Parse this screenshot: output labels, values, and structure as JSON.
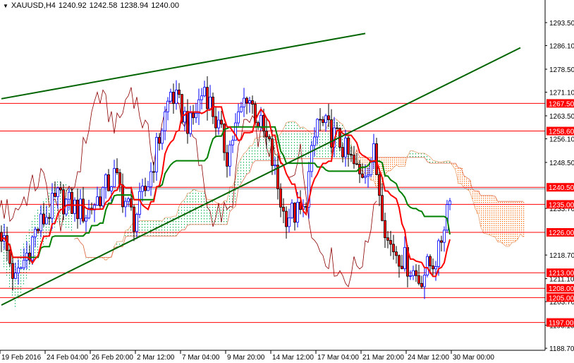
{
  "header": {
    "symbol": "XAUUSD,H4",
    "open": "1240.92",
    "high": "1242.58",
    "low": "1238.94",
    "close": "1240.00"
  },
  "colors": {
    "bull_outline": "#0000ff",
    "bull_body": "#ffffff",
    "bear_outline": "#000000",
    "bear_body": "#ff0000",
    "tenkan": "#ff0000",
    "kijun": "#008000",
    "chikou": "#8b0000",
    "cloud_bull": "#00b050",
    "cloud_bear": "#ff6600",
    "levels": "#ff0000",
    "trendline": "#006400",
    "current_price": "#8899aa"
  },
  "chart_data": {
    "type": "candlestick",
    "title": "XAUUSD,H4",
    "ylim": [
      1186.5,
      1300
    ],
    "y_ticks": [
      "1293.50",
      "1286.10",
      "1278.50",
      "1271.10",
      "1263.50",
      "1256.10",
      "1248.50",
      "1233.70",
      "1218.70",
      "1211.10",
      "1203.70",
      "1196.10",
      "1188.70"
    ],
    "x_ticks": [
      {
        "bar": 0,
        "label": "19 Feb 2016"
      },
      {
        "bar": 16,
        "label": "24 Feb 04:00"
      },
      {
        "bar": 32,
        "label": "26 Feb 20:00"
      },
      {
        "bar": 48,
        "label": "2 Mar 12:00"
      },
      {
        "bar": 64,
        "label": "7 Mar 04:00"
      },
      {
        "bar": 80,
        "label": "9 Mar 20:00"
      },
      {
        "bar": 96,
        "label": "14 Mar 12:00"
      },
      {
        "bar": 112,
        "label": "17 Mar 04:00"
      },
      {
        "bar": 128,
        "label": "21 Mar 20:00"
      },
      {
        "bar": 144,
        "label": "24 Mar 12:00"
      },
      {
        "bar": 160,
        "label": "30 Mar 00:00"
      }
    ],
    "bars": 160,
    "price_path": [
      [
        0,
        1226
      ],
      [
        5,
        1210
      ],
      [
        12,
        1226
      ],
      [
        20,
        1237
      ],
      [
        30,
        1232
      ],
      [
        40,
        1244
      ],
      [
        47,
        1230
      ],
      [
        52,
        1242
      ],
      [
        60,
        1271
      ],
      [
        67,
        1260
      ],
      [
        72,
        1273
      ],
      [
        80,
        1251
      ],
      [
        87,
        1271
      ],
      [
        95,
        1253
      ],
      [
        100,
        1232
      ],
      [
        107,
        1232
      ],
      [
        112,
        1262
      ],
      [
        120,
        1255
      ],
      [
        127,
        1244
      ],
      [
        132,
        1251
      ],
      [
        137,
        1223
      ],
      [
        143,
        1217
      ],
      [
        148,
        1211
      ],
      [
        155,
        1219
      ],
      [
        159,
        1240
      ]
    ],
    "ichimoku": {
      "tenkan": 9,
      "kijun": 26,
      "senkou_b": 52,
      "shift": 26
    },
    "levels": [
      {
        "price": 1267.5,
        "label": "1267.50"
      },
      {
        "price": 1258.6,
        "label": "1258.60"
      },
      {
        "price": 1240.5,
        "label": "1240.50"
      },
      {
        "price": 1235.0,
        "label": "1235.00"
      },
      {
        "price": 1226.0,
        "label": "1226.00"
      },
      {
        "price": 1213.0,
        "label": "1213.00"
      },
      {
        "price": 1208.0,
        "label": "1208.00"
      },
      {
        "price": 1205.0,
        "label": "1205.00"
      },
      {
        "price": 1197.0,
        "label": "1197.00"
      }
    ],
    "current_price": 1240.0,
    "trendlines": [
      {
        "name": "upper-trendline",
        "from": [
          0,
          1269.0
        ],
        "to": [
          129,
          1290.0
        ]
      },
      {
        "name": "lower-trendline",
        "from": [
          0,
          1202.6
        ],
        "to": [
          184,
          1285.4
        ]
      }
    ]
  }
}
